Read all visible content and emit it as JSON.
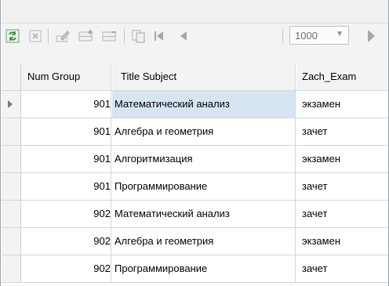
{
  "pager": {
    "page_size": "1000"
  },
  "icons": {
    "refresh": "refresh-icon",
    "cancel": "cancel-icon",
    "edit": "edit-icon",
    "add_row": "add-row-icon",
    "delete_row": "delete-row-icon",
    "copy": "copy-icon",
    "first": "first-page-icon",
    "prev": "previous-page-icon",
    "next": "next-page-icon"
  },
  "columns": [
    "Num Group",
    "Title Subject",
    "Zach_Exam"
  ],
  "rows": [
    [
      "901",
      "Математический анализ",
      "экзамен"
    ],
    [
      "901",
      "Алгебра и геометрия",
      "зачет"
    ],
    [
      "901",
      "Алгоритмизация",
      "экзамен"
    ],
    [
      "901",
      "Программирование",
      "зачет"
    ],
    [
      "902",
      "Математический анализ",
      "зачет"
    ],
    [
      "902",
      "Алгебра и геометрия",
      "экзамен"
    ],
    [
      "902",
      "Программирование",
      "зачет"
    ]
  ],
  "colors": {
    "selected_cell": "#d7e4f2",
    "accent_green": "#2f8b3a"
  }
}
